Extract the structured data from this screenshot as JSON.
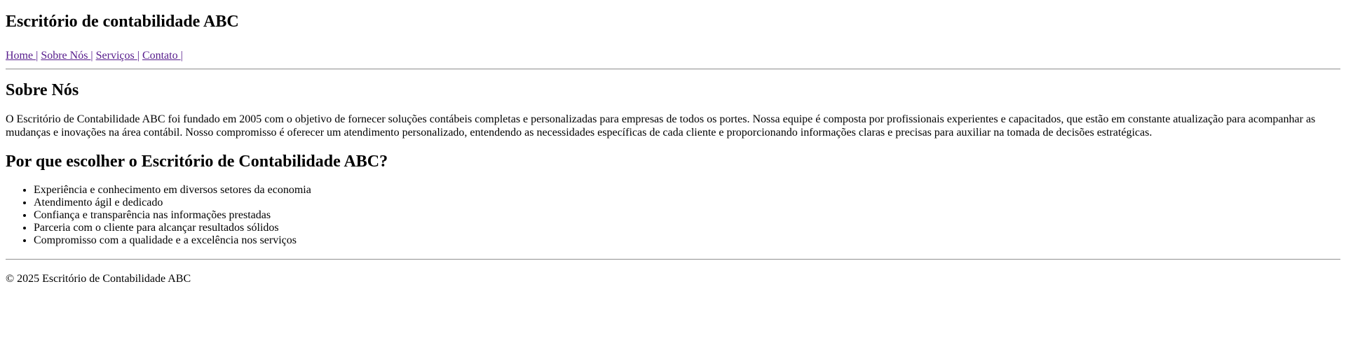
{
  "header": {
    "title": "Escritório de contabilidade ABC"
  },
  "nav": {
    "items": [
      {
        "label": "Home "
      },
      {
        "label": "Sobre Nós "
      },
      {
        "label": "Serviços "
      },
      {
        "label": "Contato "
      }
    ],
    "separator": "|"
  },
  "about": {
    "heading": "Sobre Nós",
    "text": "O Escritório de Contabilidade ABC foi fundado em 2005 com o objetivo de fornecer soluções contábeis completas e personalizadas para empresas de todos os portes. Nossa equipe é composta por profissionais experientes e capacitados, que estão em constante atualização para acompanhar as mudanças e inovações na área contábil. Nosso compromisso é oferecer um atendimento personalizado, entendendo as necessidades específicas de cada cliente e proporcionando informações claras e precisas para auxiliar na tomada de decisões estratégicas."
  },
  "why": {
    "heading": "Por que escolher o Escritório de Contabilidade ABC?",
    "items": [
      "Experiência e conhecimento em diversos setores da economia",
      "Atendimento ágil e dedicado",
      "Confiança e transparência nas informações prestadas",
      "Parceria com o cliente para alcançar resultados sólidos",
      "Compromisso com a qualidade e a excelência nos serviços"
    ]
  },
  "footer": {
    "text": "© 2025 Escritório de Contabilidade ABC"
  },
  "colors": {
    "visited_link": "#551a8b",
    "text": "#000000",
    "background": "#ffffff"
  }
}
